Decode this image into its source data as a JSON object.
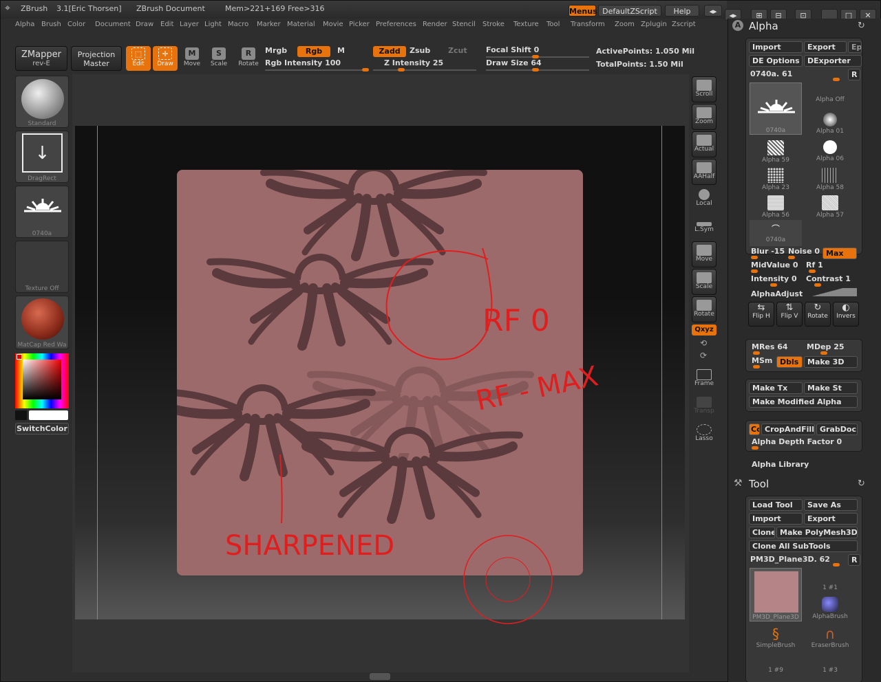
{
  "titlebar": {
    "app": "ZBrush",
    "version": "3.1[Eric Thorsen]",
    "document": "ZBrush Document",
    "mem": "Mem>221+169",
    "free": "Free>316",
    "menus_btn": "Menus",
    "script_btn": "DefaultZScript",
    "help_btn": "Help"
  },
  "menubar": [
    "Alpha",
    "Brush",
    "Color",
    "Document",
    "Draw",
    "Edit",
    "Layer",
    "Light",
    "Macro",
    "Marker",
    "Material",
    "Movie",
    "Picker",
    "Preferences",
    "Render",
    "Stencil",
    "Stroke",
    "Texture",
    "Tool",
    "Transform",
    "Zoom",
    "Zplugin",
    "Zscript"
  ],
  "toolbar": {
    "zmapper": "ZMapper",
    "zmapper_sub": "rev-E",
    "projection": "Projection",
    "projection_sub": "Master",
    "tools": [
      {
        "label": "Edit",
        "glyph": "⬚"
      },
      {
        "label": "Draw",
        "glyph": "✛"
      },
      {
        "label": "Move",
        "glyph": "M"
      },
      {
        "label": "Scale",
        "glyph": "S"
      },
      {
        "label": "Rotate",
        "glyph": "R"
      }
    ],
    "mrgb": "Mrgb",
    "rgb": "Rgb",
    "m": "M",
    "rgb_intensity": "Rgb Intensity 100",
    "zadd": "Zadd",
    "zsub": "Zsub",
    "zcut": "Zcut",
    "z_intensity": "Z Intensity 25",
    "focal_shift": "Focal Shift 0",
    "draw_size": "Draw Size 64",
    "active_points": "ActivePoints: 1.050 Mil",
    "total_points": "TotalPoints: 1.50 Mil"
  },
  "left_panel": {
    "brush": "Standard",
    "stroke": "DragRect",
    "alpha": "0740a",
    "texture": "Texture Off",
    "material": "MatCap Red Wa",
    "switch_color": "SwitchColor"
  },
  "annotations": {
    "rf0": "RF 0",
    "rfmax": "RF - MAX",
    "sharpened": "SHARPENED"
  },
  "shelf": [
    {
      "label": "Scroll"
    },
    {
      "label": "Zoom"
    },
    {
      "label": "Actual"
    },
    {
      "label": "AAHalf"
    },
    {
      "label": "Local"
    },
    {
      "label": "L.Sym"
    },
    {
      "label": "Move"
    },
    {
      "label": "Scale"
    },
    {
      "label": "Rotate"
    },
    {
      "label": "Qxyz"
    },
    {
      "label": ""
    },
    {
      "label": ""
    },
    {
      "label": "Frame"
    },
    {
      "label": "Transp"
    },
    {
      "label": "Lasso"
    }
  ],
  "alpha_palette": {
    "title": "Alpha",
    "import": "Import",
    "export": "Export",
    "ep": "Ep",
    "de_options": "DE Options",
    "dexporter": "DExporter",
    "current": "0740a. 61",
    "r": "R",
    "items": [
      "0740a",
      "Alpha Off",
      "Alpha 01",
      "Alpha 59",
      "Alpha 06",
      "Alpha 23",
      "Alpha 58",
      "Alpha 56",
      "Alpha 57",
      "0740a"
    ],
    "blur": "Blur -15",
    "noise": "Noise 0",
    "max": "Max",
    "midvalue": "MidValue 0",
    "rf": "Rf 1",
    "intensity": "Intensity 0",
    "contrast": "Contrast 1",
    "alpha_adjust": "AlphaAdjust",
    "flips": [
      "Flip H",
      "Flip V",
      "Rotate",
      "Invers"
    ],
    "mres": "MRes 64",
    "mdep": "MDep 25",
    "msm": "MSm",
    "dbls": "Dbls",
    "make3d": "Make 3D",
    "make_tx": "Make Tx",
    "make_st": "Make St",
    "make_modified": "Make Modified Alpha",
    "cc": "Cc",
    "crop_fill": "CropAndFill",
    "grab_doc": "GrabDoc",
    "depth_factor": "Alpha Depth Factor 0",
    "library": "Alpha Library"
  },
  "tool_palette": {
    "title": "Tool",
    "load_tool": "Load Tool",
    "save_as": "Save As",
    "import": "Import",
    "export": "Export",
    "clone": "Clone",
    "make_polymesh": "Make PolyMesh3D",
    "clone_all": "Clone All SubTools",
    "current": "PM3D_Plane3D. 62",
    "r": "R",
    "items": [
      "PM3D_Plane3D",
      "1 #1",
      "AlphaBrush",
      "SimpleBrush",
      "EraserBrush",
      "1 #9",
      "1 #3"
    ]
  }
}
